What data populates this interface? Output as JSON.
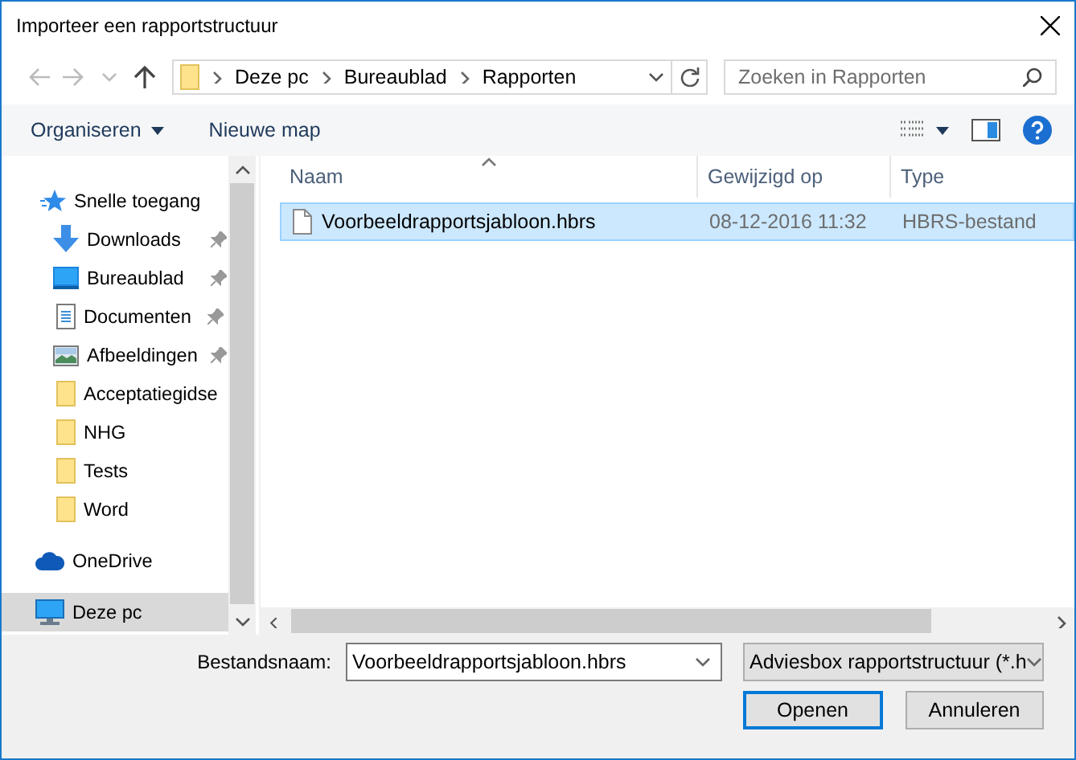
{
  "window": {
    "title": "Importeer een rapportstructuur"
  },
  "nav": {
    "path": [
      "Deze pc",
      "Bureaublad",
      "Rapporten"
    ],
    "search": {
      "placeholder": "Zoeken in Rapporten"
    }
  },
  "toolbar": {
    "organize": "Organiseren",
    "new_folder": "Nieuwe map"
  },
  "sidebar": {
    "items": [
      {
        "kind": "quick",
        "label": "Snelle toegang",
        "selected": false,
        "children": [
          {
            "kind": "downloads",
            "label": "Downloads",
            "pinned": true,
            "selected": false
          },
          {
            "kind": "desktop",
            "label": "Bureaublad",
            "pinned": true,
            "selected": false
          },
          {
            "kind": "documents",
            "label": "Documenten",
            "pinned": true,
            "selected": false
          },
          {
            "kind": "pictures",
            "label": "Afbeeldingen",
            "pinned": true,
            "selected": false
          },
          {
            "kind": "folder",
            "label": "Acceptatiegidse",
            "pinned": false,
            "selected": false
          },
          {
            "kind": "folder",
            "label": "NHG",
            "pinned": false,
            "selected": false
          },
          {
            "kind": "folder",
            "label": "Tests",
            "pinned": false,
            "selected": false
          },
          {
            "kind": "folder",
            "label": "Word",
            "pinned": false,
            "selected": false
          }
        ]
      },
      {
        "kind": "onedrive",
        "label": "OneDrive",
        "selected": false
      },
      {
        "kind": "pc",
        "label": "Deze pc",
        "selected": true
      }
    ]
  },
  "table": {
    "columns": [
      {
        "label": "Naam",
        "sorted": true
      },
      {
        "label": "Gewijzigd op",
        "sorted": false
      },
      {
        "label": "Type",
        "sorted": false
      }
    ],
    "rows": [
      {
        "name": "Voorbeeldrapportsjabloon.hbrs",
        "modified": "08-12-2016 11:32",
        "type": "HBRS-bestand",
        "selected": true
      }
    ]
  },
  "bottom": {
    "filename_label": "Bestandsnaam:",
    "filename": "Voorbeeldrapportsjabloon.hbrs",
    "filter": "Adviesbox rapportstructuur (*.h",
    "buttons": [
      {
        "label": "Openen",
        "default": true
      },
      {
        "label": "Annuleren",
        "default": false
      }
    ]
  }
}
